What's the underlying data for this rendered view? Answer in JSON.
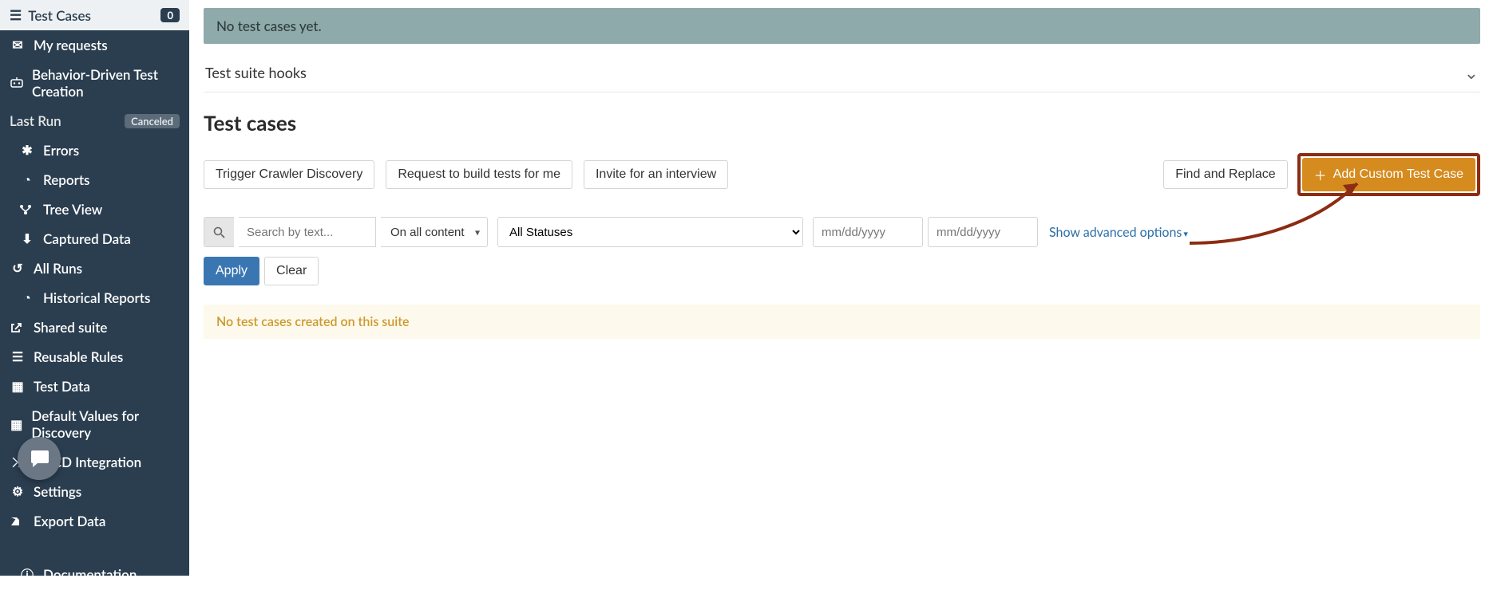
{
  "sidebar": {
    "top": {
      "label": "Test Cases",
      "badge": "0"
    },
    "my_requests": "My requests",
    "bdtc": "Behavior-Driven Test Creation",
    "last_run": {
      "label": "Last Run",
      "status": "Canceled"
    },
    "items": {
      "errors": "Errors",
      "reports": "Reports",
      "tree": "Tree View",
      "captured": "Captured Data",
      "all_runs": "All Runs",
      "historical": "Historical Reports",
      "shared_suite": "Shared suite",
      "rules": "Reusable Rules",
      "test_data": "Test Data",
      "defaults": "Default Values for Discovery",
      "cicd": "CI/CD Integration",
      "settings": "Settings",
      "export": "Export Data",
      "docs": "Documentation"
    }
  },
  "main": {
    "no_tests_banner": "No test cases yet.",
    "hooks_title": "Test suite hooks",
    "section_title": "Test cases",
    "buttons": {
      "trigger": "Trigger Crawler Discovery",
      "request": "Request to build tests for me",
      "invite": "Invite for an interview",
      "find_replace": "Find and Replace",
      "add_custom": "Add Custom Test Case"
    },
    "filters": {
      "search_placeholder": "Search by text...",
      "content_scope": "On all content",
      "status": "All Statuses",
      "date_placeholder": "mm/dd/yyyy",
      "advanced": "Show advanced options",
      "apply": "Apply",
      "clear": "Clear"
    },
    "empty_suite_msg": "No test cases created on this suite"
  }
}
